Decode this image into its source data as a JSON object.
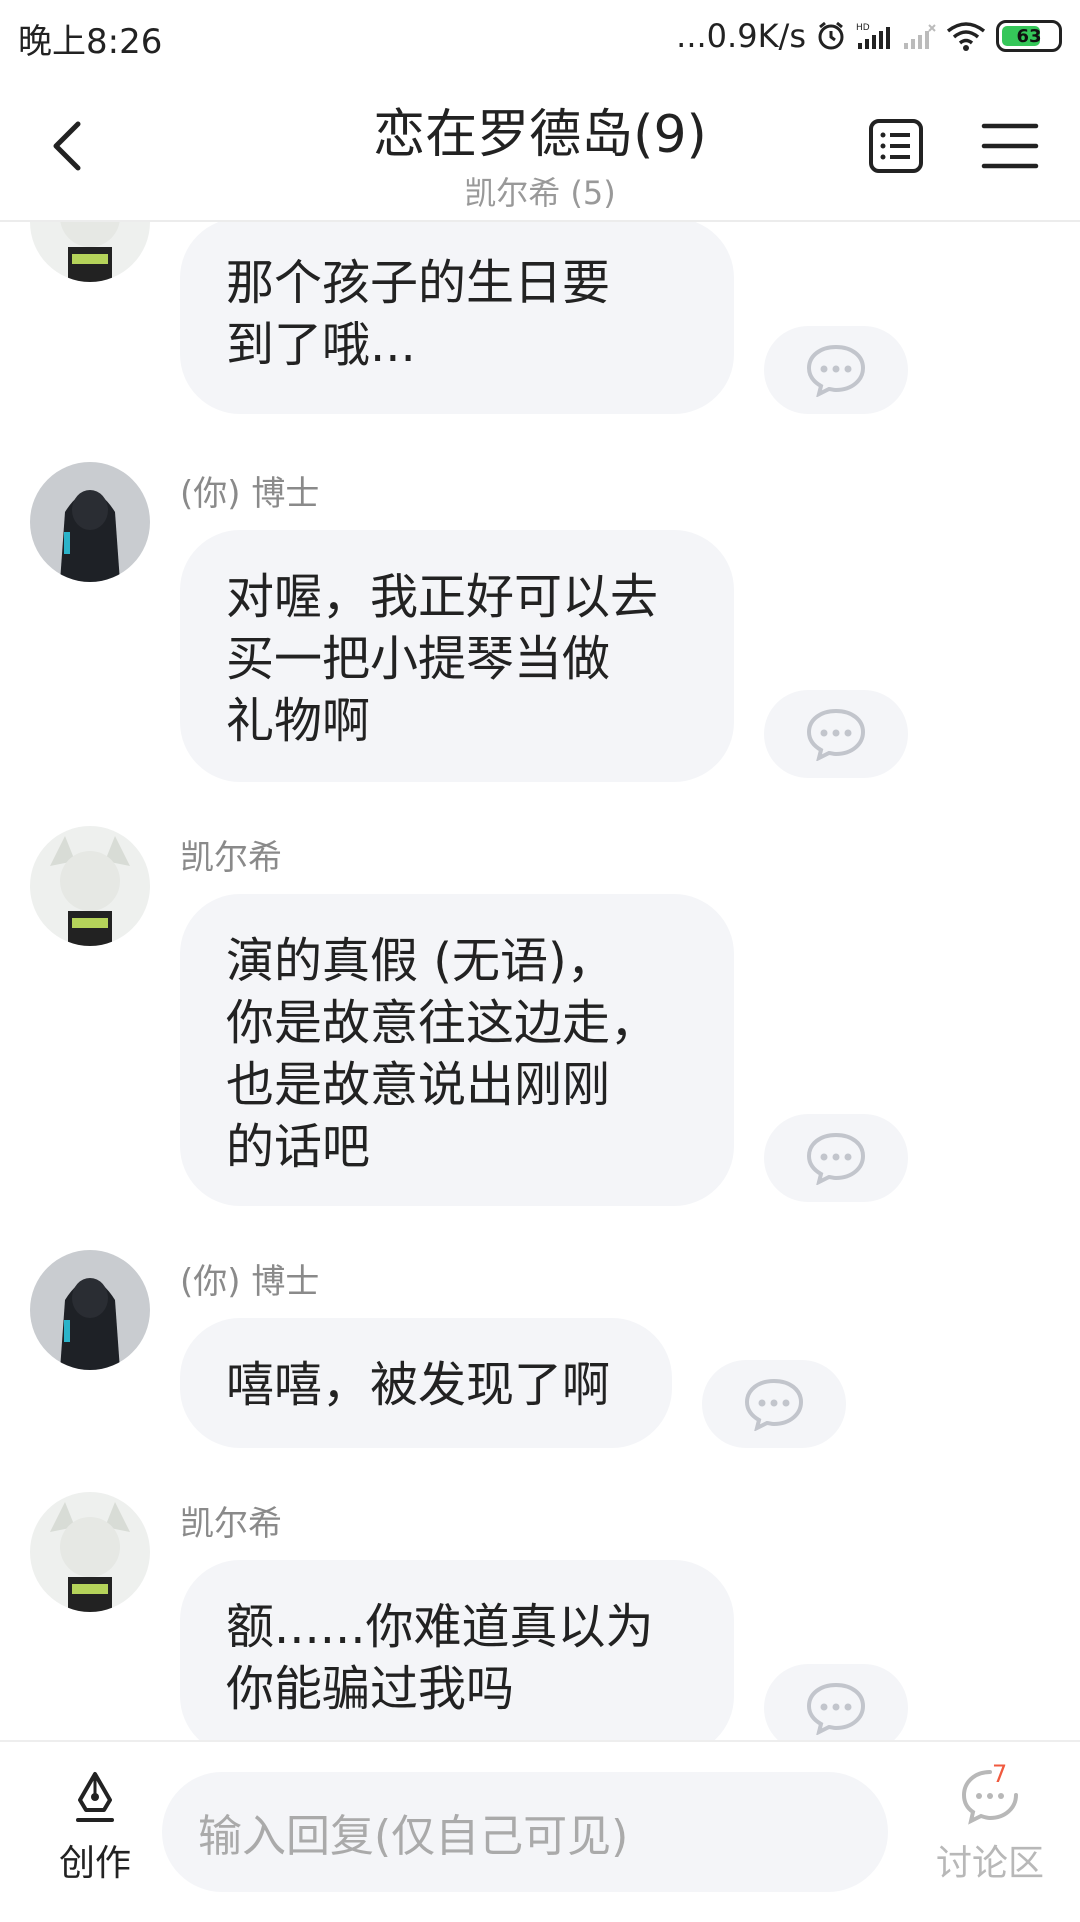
{
  "status_bar": {
    "time": "晚上8:26",
    "network_speed": "...0.9K/s",
    "battery": "63",
    "icons": [
      "alarm-icon",
      "hd-signal-icon",
      "signal-icon",
      "wifi-icon",
      "battery-icon"
    ]
  },
  "header": {
    "title": "恋在罗德岛(9)",
    "subtitle": "凯尔希 (5)",
    "icons": [
      "back-icon",
      "list-icon",
      "menu-icon"
    ]
  },
  "messages": [
    {
      "sender": "",
      "text": "那个孩子的生日要\n到了哦..."
    },
    {
      "sender": "(你) 博士",
      "text": "对喔，我正好可以去\n买一把小提琴当做\n礼物啊"
    },
    {
      "sender": "凯尔希",
      "text": "演的真假 (无语)，\n你是故意往这边走，\n也是故意说出刚刚\n的话吧"
    },
    {
      "sender": "(你) 博士",
      "text": "嘻嘻，被发现了啊"
    },
    {
      "sender": "凯尔希",
      "text": "额......你难道真以为\n你能骗过我吗"
    }
  ],
  "bottom_bar": {
    "create_label": "创作",
    "reply_placeholder": "输入回复(仅自己可见)",
    "discuss_label": "讨论区",
    "discuss_badge": "7"
  },
  "colors": {
    "bubble": "#f4f5f8",
    "badge": "#f05a3f",
    "battery_fill": "#35c759"
  }
}
